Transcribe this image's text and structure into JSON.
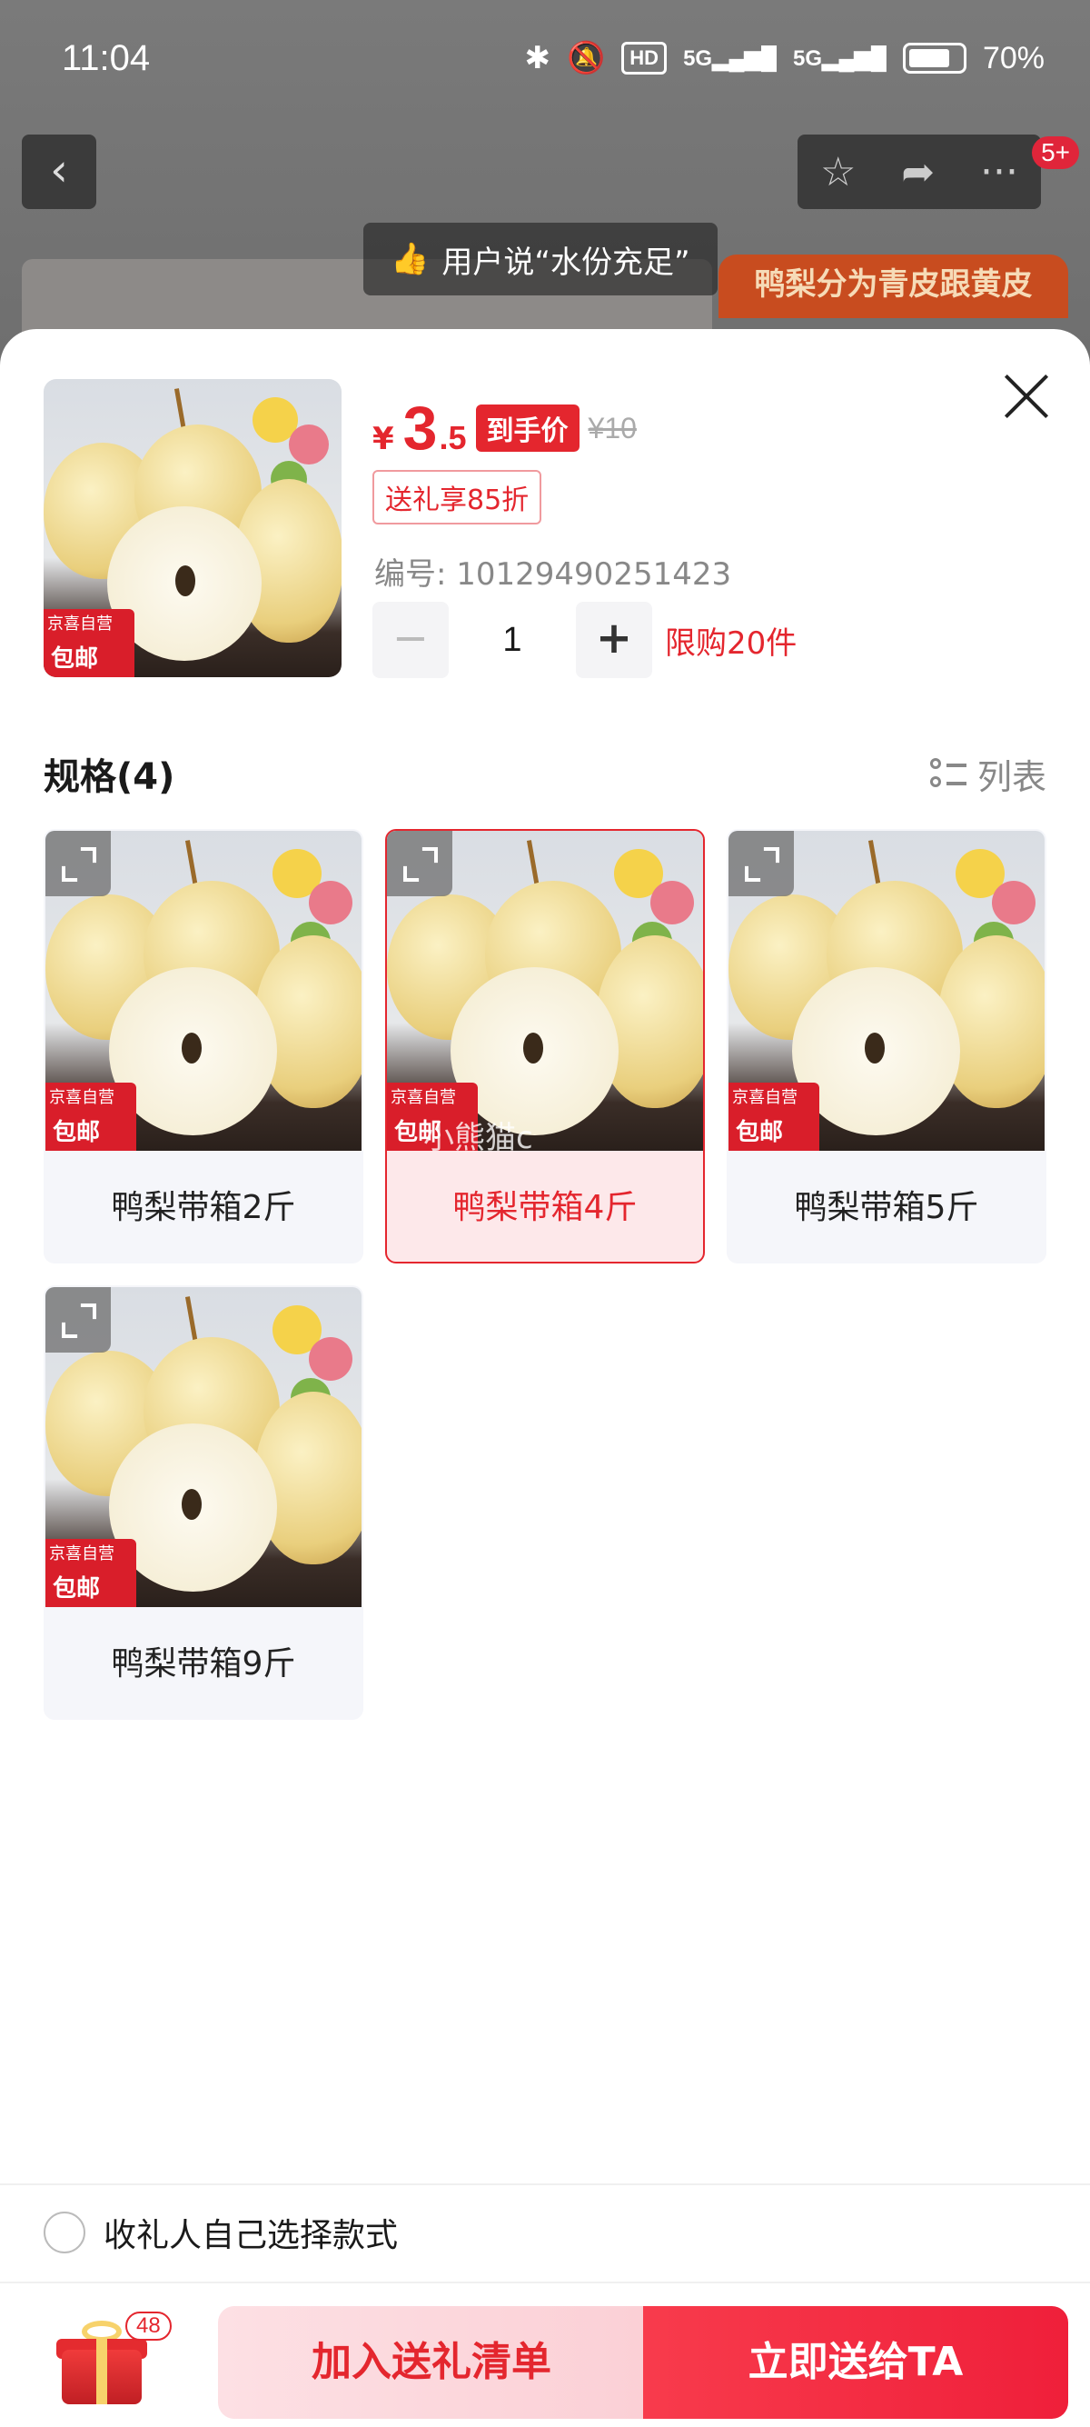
{
  "status_bar": {
    "time": "11:04",
    "battery": "70%",
    "network_labels": [
      "HD",
      "5G",
      "5G"
    ]
  },
  "background": {
    "tip": "用户说“水份充足”",
    "banner": "鸭梨分为青皮跟黄皮",
    "notification_badge": "5+"
  },
  "product": {
    "currency": "¥",
    "price_int": "3",
    "price_dec": ".5",
    "price_tag": "到手价",
    "original_price": "¥10",
    "gift_discount": "送礼享85折",
    "sku_label": "编号: 10129490251423",
    "quantity": "1",
    "limit": "限购20件",
    "badge_brand": "京喜自营",
    "badge_shipping": "包邮"
  },
  "specs": {
    "title": "规格(4)",
    "view_toggle": "列表",
    "selected_index": 1,
    "items": [
      {
        "label": "鸭梨带箱2斤"
      },
      {
        "label": "鸭梨带箱4斤"
      },
      {
        "label": "鸭梨带箱5斤"
      },
      {
        "label": "鸭梨带箱9斤"
      }
    ],
    "watermark": "小熊猫c"
  },
  "recipient_option": "收礼人自己选择款式",
  "bottom": {
    "gift_count": "48",
    "add_button": "加入送礼清单",
    "send_button": "立即送给TA"
  },
  "colors": {
    "accent": "#e4262e",
    "selected_bg": "#fde8ea"
  }
}
